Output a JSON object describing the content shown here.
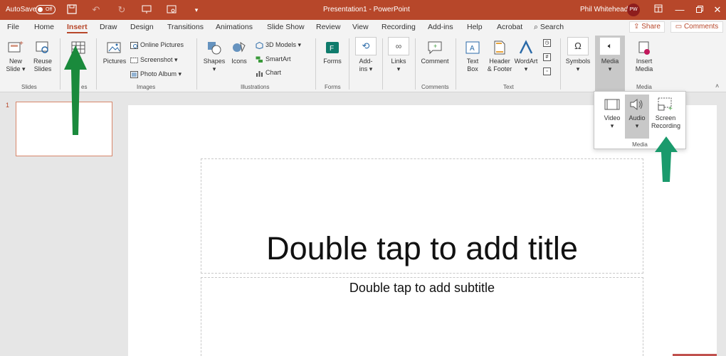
{
  "titlebar": {
    "autosave_label": "AutoSave",
    "autosave_state": "Off",
    "document_title": "Presentation1 - PowerPoint",
    "user_name": "Phil Whitehead",
    "user_initials": "PW"
  },
  "tabs": [
    "File",
    "Home",
    "Insert",
    "Draw",
    "Design",
    "Transitions",
    "Animations",
    "Slide Show",
    "Review",
    "View",
    "Recording",
    "Add-ins",
    "Help",
    "Acrobat"
  ],
  "active_tab": "Insert",
  "search_label": "Search",
  "share_label": "Share",
  "comments_label": "Comments",
  "ribbon": {
    "slides": {
      "new_slide": [
        "New",
        "Slide"
      ],
      "reuse_slides": [
        "Reuse",
        "Slides"
      ],
      "group": "Slides"
    },
    "tables": {
      "group_partial": "es"
    },
    "images": {
      "pictures": "Pictures",
      "online_pictures": "Online Pictures",
      "screenshot": "Screenshot",
      "photo_album": "Photo Album",
      "group": "Images"
    },
    "illustrations": {
      "shapes": "Shapes",
      "icons": "Icons",
      "models_3d": "3D Models",
      "smartart": "SmartArt",
      "chart": "Chart",
      "group": "Illustrations"
    },
    "forms": {
      "forms": "Forms",
      "group": "Forms"
    },
    "addins": {
      "label": [
        "Add-",
        "ins"
      ]
    },
    "links": {
      "label": "Links"
    },
    "comments": {
      "comment": "Comment",
      "group": "Comments"
    },
    "text": {
      "text_box": [
        "Text",
        "Box"
      ],
      "header_footer": [
        "Header",
        "& Footer"
      ],
      "wordart": "WordArt",
      "group": "Text"
    },
    "symbols": {
      "label": "Symbols"
    },
    "media": {
      "media": "Media",
      "insert_media": [
        "Insert",
        "Media"
      ],
      "group": "Media"
    }
  },
  "media_dropdown": {
    "video": "Video",
    "audio": "Audio",
    "screen_recording": [
      "Screen",
      "Recording"
    ],
    "group": "Media"
  },
  "slide_panel": {
    "slide_number": "1"
  },
  "slide": {
    "title_placeholder": "Double tap to add title",
    "subtitle_placeholder": "Double tap to add subtitle"
  },
  "colors": {
    "accent": "#b7472a",
    "arrow_green": "#1a8a3c",
    "arrow_teal": "#1a9a6c"
  }
}
